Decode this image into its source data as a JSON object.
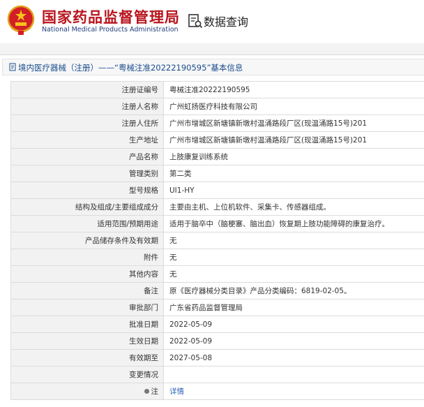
{
  "header": {
    "brand_cn": "国家药品监督管理局",
    "brand_en": "National Medical Products Administration",
    "query_label": "数据查询",
    "emblem_icon": "national-emblem-icon",
    "query_icon": "document-search-icon",
    "brand_color": "#b8141c"
  },
  "breadcrumb": {
    "text": "境内医疗器械（注册）——“粤械注准20222190595”基本信息",
    "icon": "document-icon"
  },
  "details": [
    {
      "key": "注册证编号",
      "value": "粤械注准20222190595"
    },
    {
      "key": "注册人名称",
      "value": "广州虹扬医疗科技有限公司"
    },
    {
      "key": "注册人住所",
      "value": "广州市增城区新塘镇新墩村温涌路段厂区(现温涌路15号)201"
    },
    {
      "key": "生产地址",
      "value": "广州市增城区新塘镇新墩村温涌路段厂区(现温涌路15号)201"
    },
    {
      "key": "产品名称",
      "value": "上肢康复训练系统"
    },
    {
      "key": "管理类别",
      "value": "第二类"
    },
    {
      "key": "型号规格",
      "value": "UI1-HY"
    },
    {
      "key": "结构及组成/主要组成成分",
      "value": "主要由主机、上位机软件、采集卡、传感器组成。"
    },
    {
      "key": "适用范围/预期用途",
      "value": "适用于脑卒中（脑梗塞、脑出血）恢复期上肢功能障碍的康复治疗。"
    },
    {
      "key": "产品储存条件及有效期",
      "value": "无"
    },
    {
      "key": "附件",
      "value": "无"
    },
    {
      "key": "其他内容",
      "value": "无"
    },
    {
      "key": "备注",
      "value": "原《医疗器械分类目录》产品分类编码：6819-02-05。"
    },
    {
      "key": "审批部门",
      "value": "广东省药品监督管理局"
    },
    {
      "key": "批准日期",
      "value": "2022-05-09"
    },
    {
      "key": "生效日期",
      "value": "2022-05-09"
    },
    {
      "key": "有效期至",
      "value": "2027-05-08"
    },
    {
      "key": "变更情况",
      "value": ""
    }
  ],
  "note_row": {
    "key": "注",
    "link": "详情",
    "pin_icon": "pin-icon",
    "link_color": "#2a63b8"
  }
}
